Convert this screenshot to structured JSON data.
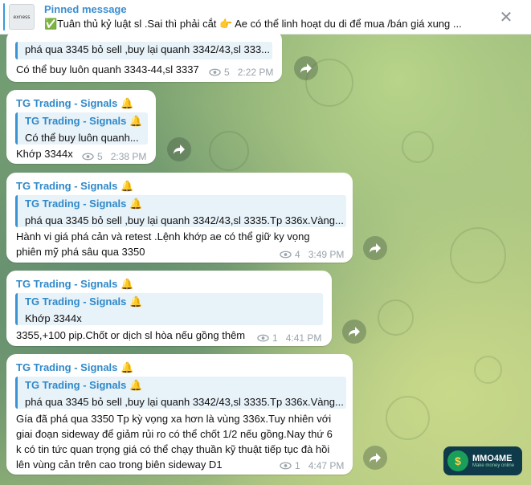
{
  "pinned": {
    "title": "Pinned message",
    "thumb_label": "exness",
    "text": "✅Tuân thủ kỷ luật sl .Sai thì phải cắt  👉 Ae có thể linh hoạt du di để mua /bán giá xung ...",
    "close_glyph": "✕"
  },
  "messages": [
    {
      "quote_text": "phá qua 3345 bỏ sell ,buy lại quanh 3342/43,sl 333...",
      "text": "Có thể buy luôn quanh 3343-44,sl 3337",
      "views": "5",
      "time": "2:22 PM"
    },
    {
      "sender": "TG Trading - Signals 🔔",
      "quote_sender": "TG Trading - Signals 🔔",
      "quote_text": "Có thể buy luôn quanh...",
      "text": "Khớp 3344x",
      "views": "5",
      "time": "2:38 PM"
    },
    {
      "sender": "TG Trading - Signals 🔔",
      "quote_sender": "TG Trading - Signals 🔔",
      "quote_text": "phá qua 3345 bỏ sell ,buy lại quanh 3342/43,sl 3335.Tp 336x.Vàng...",
      "text_line1": "Hành vi giá  phá cản và retest .Lệnh khớp ae có thể giữ ky vọng",
      "text_line2": "phiên mỹ phá sâu qua 3350",
      "views": "4",
      "time": "3:49 PM"
    },
    {
      "sender": "TG Trading - Signals 🔔",
      "quote_sender": "TG Trading - Signals 🔔",
      "quote_text": "Khớp 3344x",
      "text": "3355,+100 pip.Chốt or dịch sl hòa nếu gồng thêm",
      "views": "1",
      "time": "4:41 PM"
    },
    {
      "sender": "TG Trading - Signals 🔔",
      "quote_sender": "TG Trading - Signals 🔔",
      "quote_text": "phá qua 3345 bỏ sell ,buy lại quanh 3342/43,sl 3335.Tp 336x.Vàng...",
      "text_line1": "Gía đã phá qua 3350 Tp kỳ vọng xa hơn là vùng 336x.Tuy nhiên với",
      "text_line2": "giai đoạn sideway để giảm rủi ro có thể chốt 1/2 nếu gồng.Nay thứ 6",
      "text_line3": "k có tin tức quan trọng giá có thể chạy thuần kỹ thuật tiếp tục đà hồi",
      "text_line4": "lên vùng cản trên cao trong biên sideway D1",
      "views": "1",
      "time": "4:47 PM"
    }
  ],
  "watermark": {
    "logo_glyph": "$",
    "name": "MMO4ME",
    "sub": "Make money online"
  }
}
